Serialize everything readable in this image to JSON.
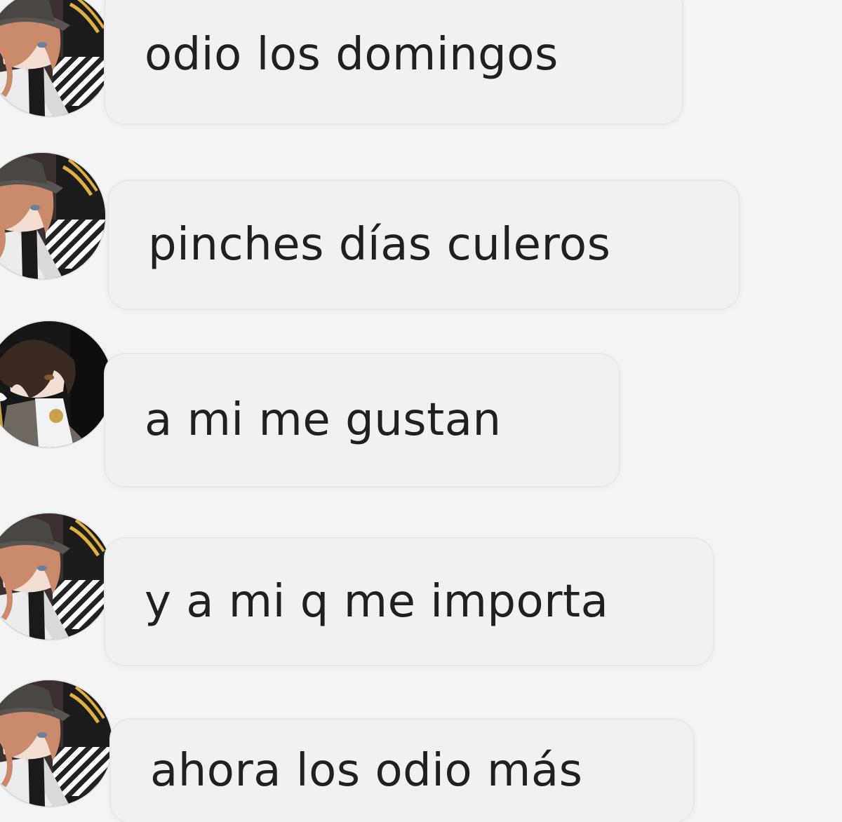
{
  "conversation": {
    "messages": [
      {
        "sender_avatar": "chuuya-avatar",
        "text": "odio los domingos"
      },
      {
        "sender_avatar": "chuuya-avatar",
        "text": "pinches días culeros"
      },
      {
        "sender_avatar": "dazai-avatar",
        "text": "a mi me gustan"
      },
      {
        "sender_avatar": "chuuya-avatar",
        "text": "y a mi q me importa"
      },
      {
        "sender_avatar": "chuuya-avatar",
        "text": "ahora los odio más"
      }
    ]
  },
  "colors": {
    "background": "#f4f4f5",
    "bubble": "#f1f1f2",
    "text": "#202020",
    "chuuya_hair": "#c98b6b",
    "dazai_hair": "#3a2a22"
  }
}
